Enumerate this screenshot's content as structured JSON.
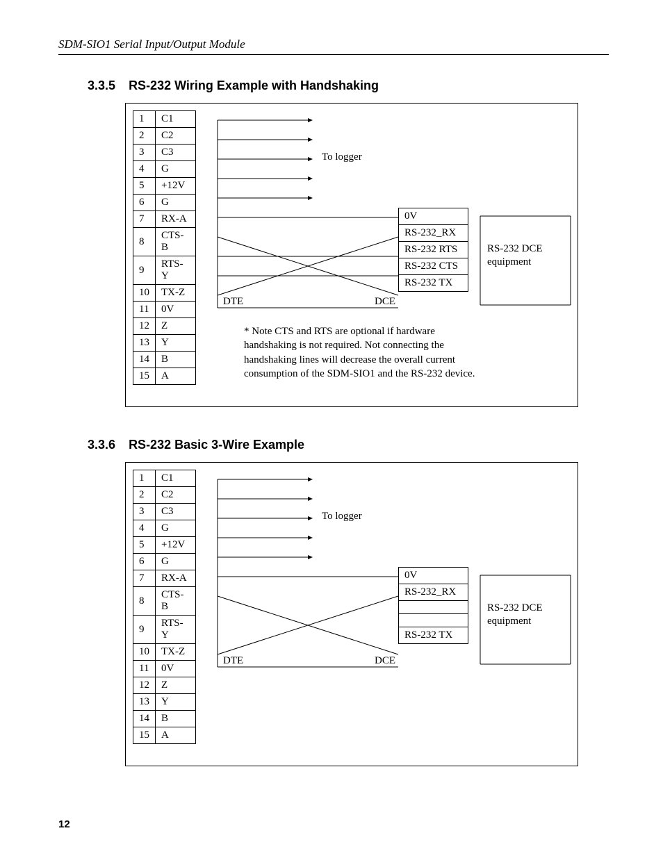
{
  "running_head": "SDM-SIO1 Serial Input/Output Module",
  "page_number": "12",
  "section_a": {
    "num": "3.3.5",
    "title": "RS-232 Wiring Example with Handshaking"
  },
  "section_b": {
    "num": "3.3.6",
    "title": "RS-232 Basic 3-Wire Example"
  },
  "pins": [
    {
      "n": "1",
      "l": "C1"
    },
    {
      "n": "2",
      "l": "C2"
    },
    {
      "n": "3",
      "l": "C3"
    },
    {
      "n": "4",
      "l": "G"
    },
    {
      "n": "5",
      "l": "+12V"
    },
    {
      "n": "6",
      "l": "G"
    },
    {
      "n": "7",
      "l": "RX-A"
    },
    {
      "n": "8",
      "l": "CTS-B"
    },
    {
      "n": "9",
      "l": "RTS-Y"
    },
    {
      "n": "10",
      "l": "TX-Z"
    },
    {
      "n": "11",
      "l": "0V"
    },
    {
      "n": "12",
      "l": "Z"
    },
    {
      "n": "13",
      "l": "Y"
    },
    {
      "n": "14",
      "l": "B"
    },
    {
      "n": "15",
      "l": "A"
    }
  ],
  "right_rows_a": [
    "0V",
    "RS-232_RX",
    "RS-232 RTS",
    "RS-232 CTS",
    "RS-232 TX"
  ],
  "right_rows_b": [
    "0V",
    "RS-232_RX",
    "",
    "",
    "RS-232 TX"
  ],
  "right_label": "RS-232 DCE equipment",
  "to_logger": "To logger",
  "dte": "DTE",
  "dce": "DCE",
  "note_a": "* Note CTS and RTS are optional if hardware handshaking is not required. Not connecting the handshaking lines will decrease the overall current consumption of the SDM-SIO1 and the RS-232 device."
}
